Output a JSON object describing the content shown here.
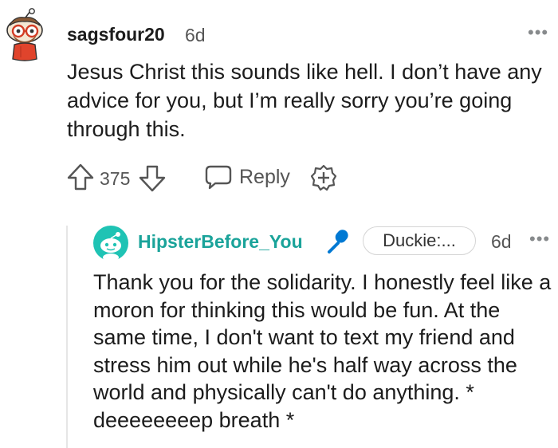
{
  "comment": {
    "username": "sagsfour20",
    "time": "6d",
    "more": "•••",
    "body": "Jesus Christ this sounds like hell. I don’t have any advice for you, but I’m really sorry you’re going through this.",
    "score": "375",
    "reply_label": "Reply"
  },
  "reply": {
    "username": "HipsterBefore_You",
    "flair": "Duckie:...",
    "time": "6d",
    "more": "•••",
    "body": "Thank you for the solidarity. I honestly feel like a moron for thinking this would be fun. At the same time, I don't want to text my friend and stress him out while he's half way across the world and physically can't do anything. * deeeeeeeep breath *"
  },
  "icons": {
    "avatar1": "snoo-avatar-glasses",
    "upvote": "upvote-arrow-icon",
    "downvote": "downvote-arrow-icon",
    "reply": "speech-bubble-icon",
    "award": "add-award-icon",
    "avatar2": "snoo-avatar-teal",
    "mic": "microphone-icon"
  },
  "colors": {
    "reply_username": "#1aa39a",
    "mic": "#0079d3",
    "meta_text": "#555555"
  }
}
